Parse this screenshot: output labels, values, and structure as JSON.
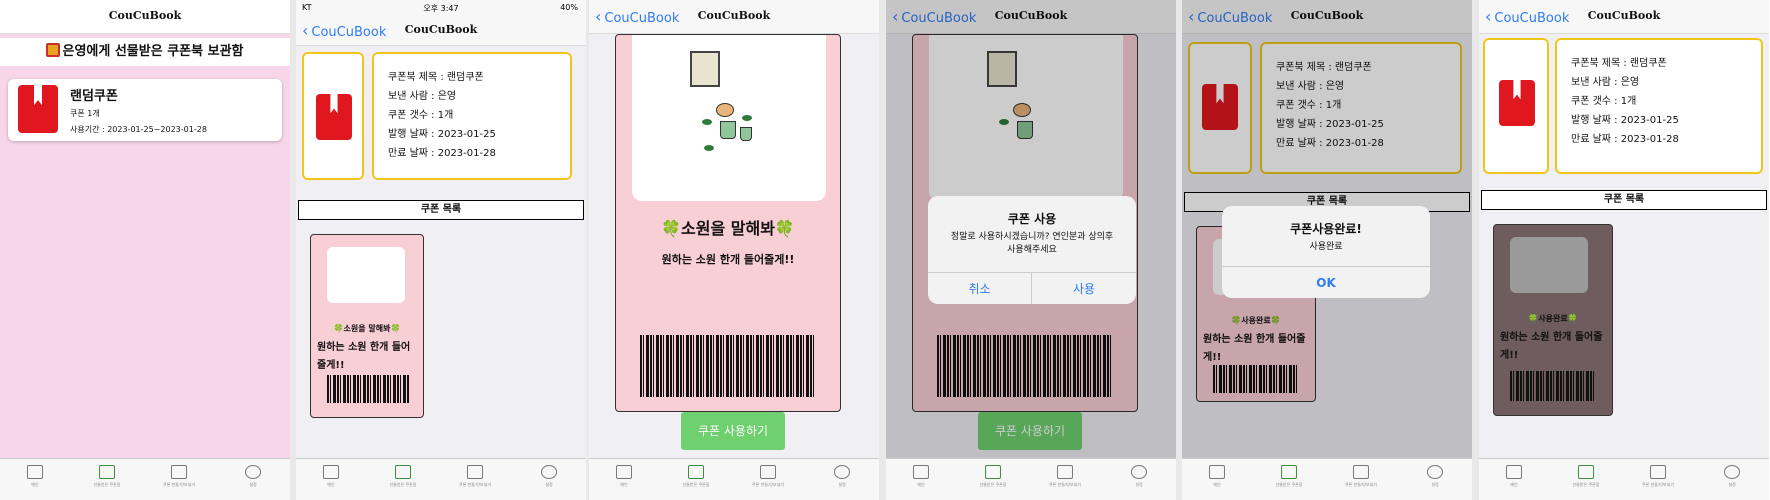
{
  "app_title": "CouCuBook",
  "back_label": "CouCuBook",
  "status_bar": {
    "carrier": "KT",
    "time": "오후 3:47",
    "battery": "40%"
  },
  "screen1": {
    "header": "은영에게 선물받은 쿠폰북 보관함",
    "coupon": {
      "title": "랜덤쿠폰",
      "count": "쿠폰 1개",
      "period": "사용기간 : 2023-01-25~2023-01-28"
    }
  },
  "detail": {
    "rows": [
      {
        "label": "쿠폰북 제목",
        "value": "랜덤쿠폰"
      },
      {
        "label": "보낸 사람",
        "value": "은영"
      },
      {
        "label": "쿠폰 갯수",
        "value": "1개"
      },
      {
        "label": "발행 날짜",
        "value": "2023-01-25"
      },
      {
        "label": "만료 날짜",
        "value": "2023-01-28"
      }
    ],
    "section_title": "쿠폰 목록"
  },
  "coupon": {
    "title": "🍀소원을 말해봐🍀",
    "desc": "원하는 소원 한개 들어줄게!!",
    "used_title": "🍀사용완료🍀"
  },
  "use_button": "쿠폰 사용하기",
  "dialog_confirm": {
    "title": "쿠폰 사용",
    "message": "정말로 사용하시겠습니까? 연인분과 상의후 사용해주세요",
    "cancel": "취소",
    "ok": "사용"
  },
  "dialog_done": {
    "title": "쿠폰사용완료!",
    "message": "사용완료",
    "ok": "OK"
  },
  "tabs": [
    {
      "label": "메인",
      "icon": "board-icon"
    },
    {
      "label": "선물받은 쿠폰함",
      "icon": "gift-icon"
    },
    {
      "label": "쿠폰 만들기/보내기",
      "icon": "add-icon"
    },
    {
      "label": "설정",
      "icon": "gear-icon"
    }
  ],
  "colors": {
    "accent": "#2f7cf6",
    "pink": "#f9cfd6",
    "yellow_border": "#f0c619",
    "green_button": "#6ed06e",
    "book_red": "#e0171f"
  }
}
